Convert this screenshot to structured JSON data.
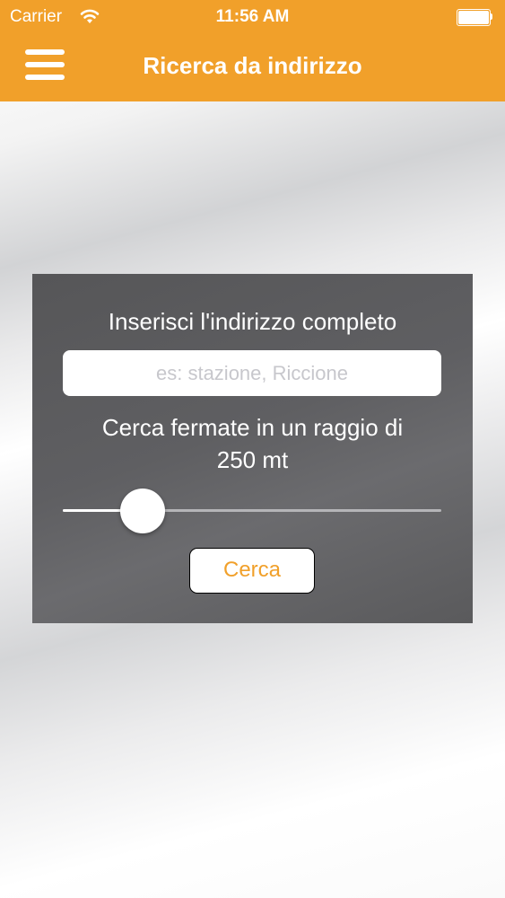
{
  "status_bar": {
    "carrier": "Carrier",
    "time": "11:56 AM",
    "wifi_icon": "wifi-icon",
    "battery_icon": "battery-icon",
    "battery_level": 1.0
  },
  "nav_bar": {
    "title": "Ricerca da indirizzo",
    "menu_icon": "hamburger-menu-icon",
    "background_color": "#f1a02a"
  },
  "search_panel": {
    "prompt": "Inserisci l'indirizzo completo",
    "address_input": {
      "value": "",
      "placeholder": "es: stazione, Riccione"
    },
    "radius_label": "Cerca fermate in un raggio di",
    "radius_value": "250 mt",
    "radius_slider_level": 0.21,
    "search_button_label": "Cerca",
    "accent_color": "#f1a02a"
  }
}
